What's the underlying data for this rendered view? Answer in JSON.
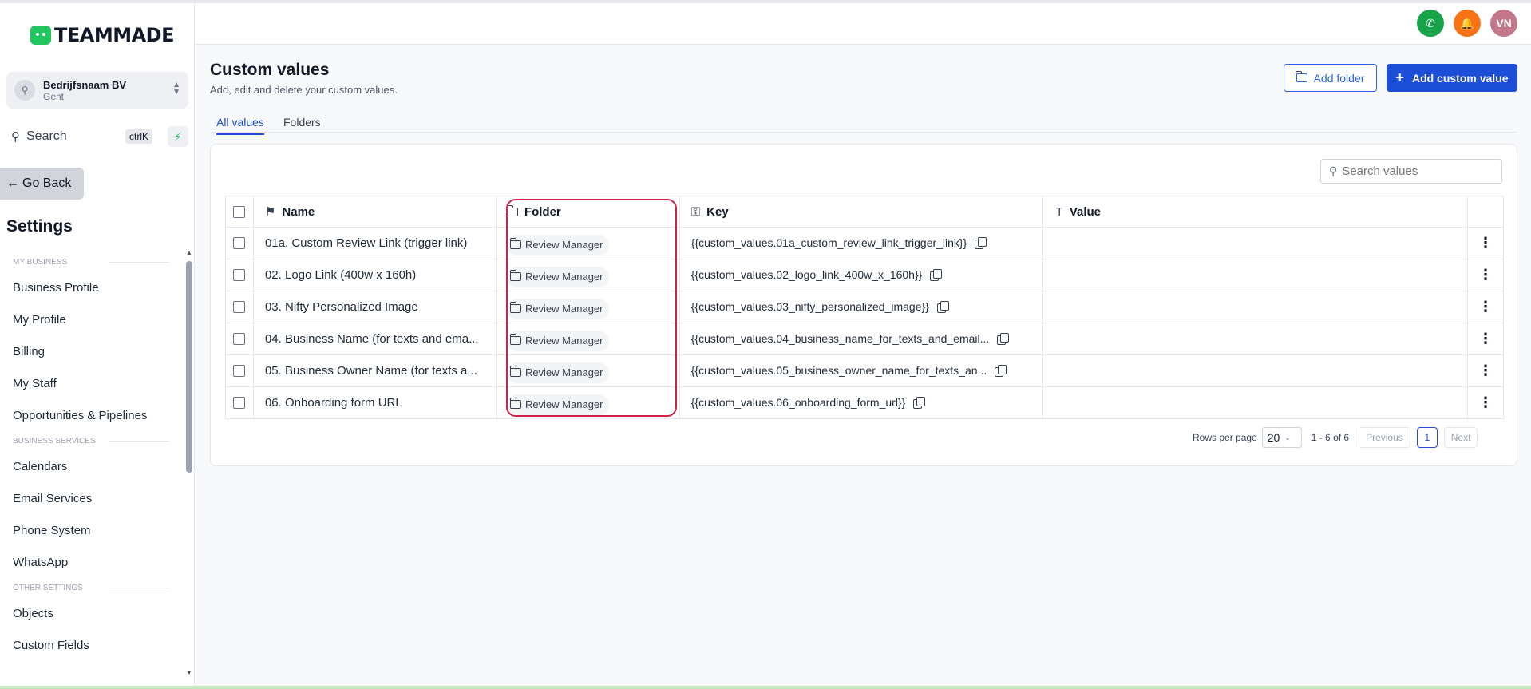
{
  "app": {
    "logo_text": "TEAMMADE"
  },
  "company": {
    "name": "Bedrijfsnaam BV",
    "location": "Gent"
  },
  "sidebar": {
    "search_label": "Search",
    "search_shortcut": "ctrlK",
    "go_back": "Go Back",
    "settings_title": "Settings",
    "sections": [
      {
        "label": "MY BUSINESS",
        "items": [
          "Business Profile",
          "My Profile",
          "Billing",
          "My Staff",
          "Opportunities & Pipelines"
        ]
      },
      {
        "label": "BUSINESS SERVICES",
        "items": [
          "Calendars",
          "Email Services",
          "Phone System",
          "WhatsApp"
        ]
      },
      {
        "label": "OTHER SETTINGS",
        "items": [
          "Objects",
          "Custom Fields"
        ]
      }
    ]
  },
  "header": {
    "avatar_initials": "VN"
  },
  "page": {
    "title": "Custom values",
    "subtitle": "Add, edit and delete your custom values.",
    "add_folder": "Add folder",
    "add_custom_value": "Add custom value",
    "tabs": [
      "All values",
      "Folders"
    ],
    "search_placeholder": "Search values"
  },
  "table": {
    "columns": {
      "name": "Name",
      "folder": "Folder",
      "key": "Key",
      "value": "Value"
    },
    "rows": [
      {
        "name": "01a. Custom Review Link (trigger link)",
        "folder": "Review Manager",
        "key": "{{custom_values.01a_custom_review_link_trigger_link}}",
        "value": ""
      },
      {
        "name": "02. Logo Link (400w x 160h)",
        "folder": "Review Manager",
        "key": "{{custom_values.02_logo_link_400w_x_160h}}",
        "value": ""
      },
      {
        "name": "03. Nifty Personalized Image",
        "folder": "Review Manager",
        "key": "{{custom_values.03_nifty_personalized_image}}",
        "value": ""
      },
      {
        "name": "04. Business Name (for texts and ema...",
        "folder": "Review Manager",
        "key": "{{custom_values.04_business_name_for_texts_and_email...",
        "value": ""
      },
      {
        "name": "05. Business Owner Name (for texts a...",
        "folder": "Review Manager",
        "key": "{{custom_values.05_business_owner_name_for_texts_an...",
        "value": ""
      },
      {
        "name": "06. Onboarding form URL",
        "folder": "Review Manager",
        "key": "{{custom_values.06_onboarding_form_url}}",
        "value": ""
      }
    ]
  },
  "pagination": {
    "rows_per_page_label": "Rows per page",
    "rows_per_page": "20",
    "range": "1 - 6 of 6",
    "previous": "Previous",
    "page": "1",
    "next": "Next"
  },
  "colors": {
    "accent": "#1d4ed8",
    "highlight": "#d0214b",
    "brand": "#22c55e"
  }
}
